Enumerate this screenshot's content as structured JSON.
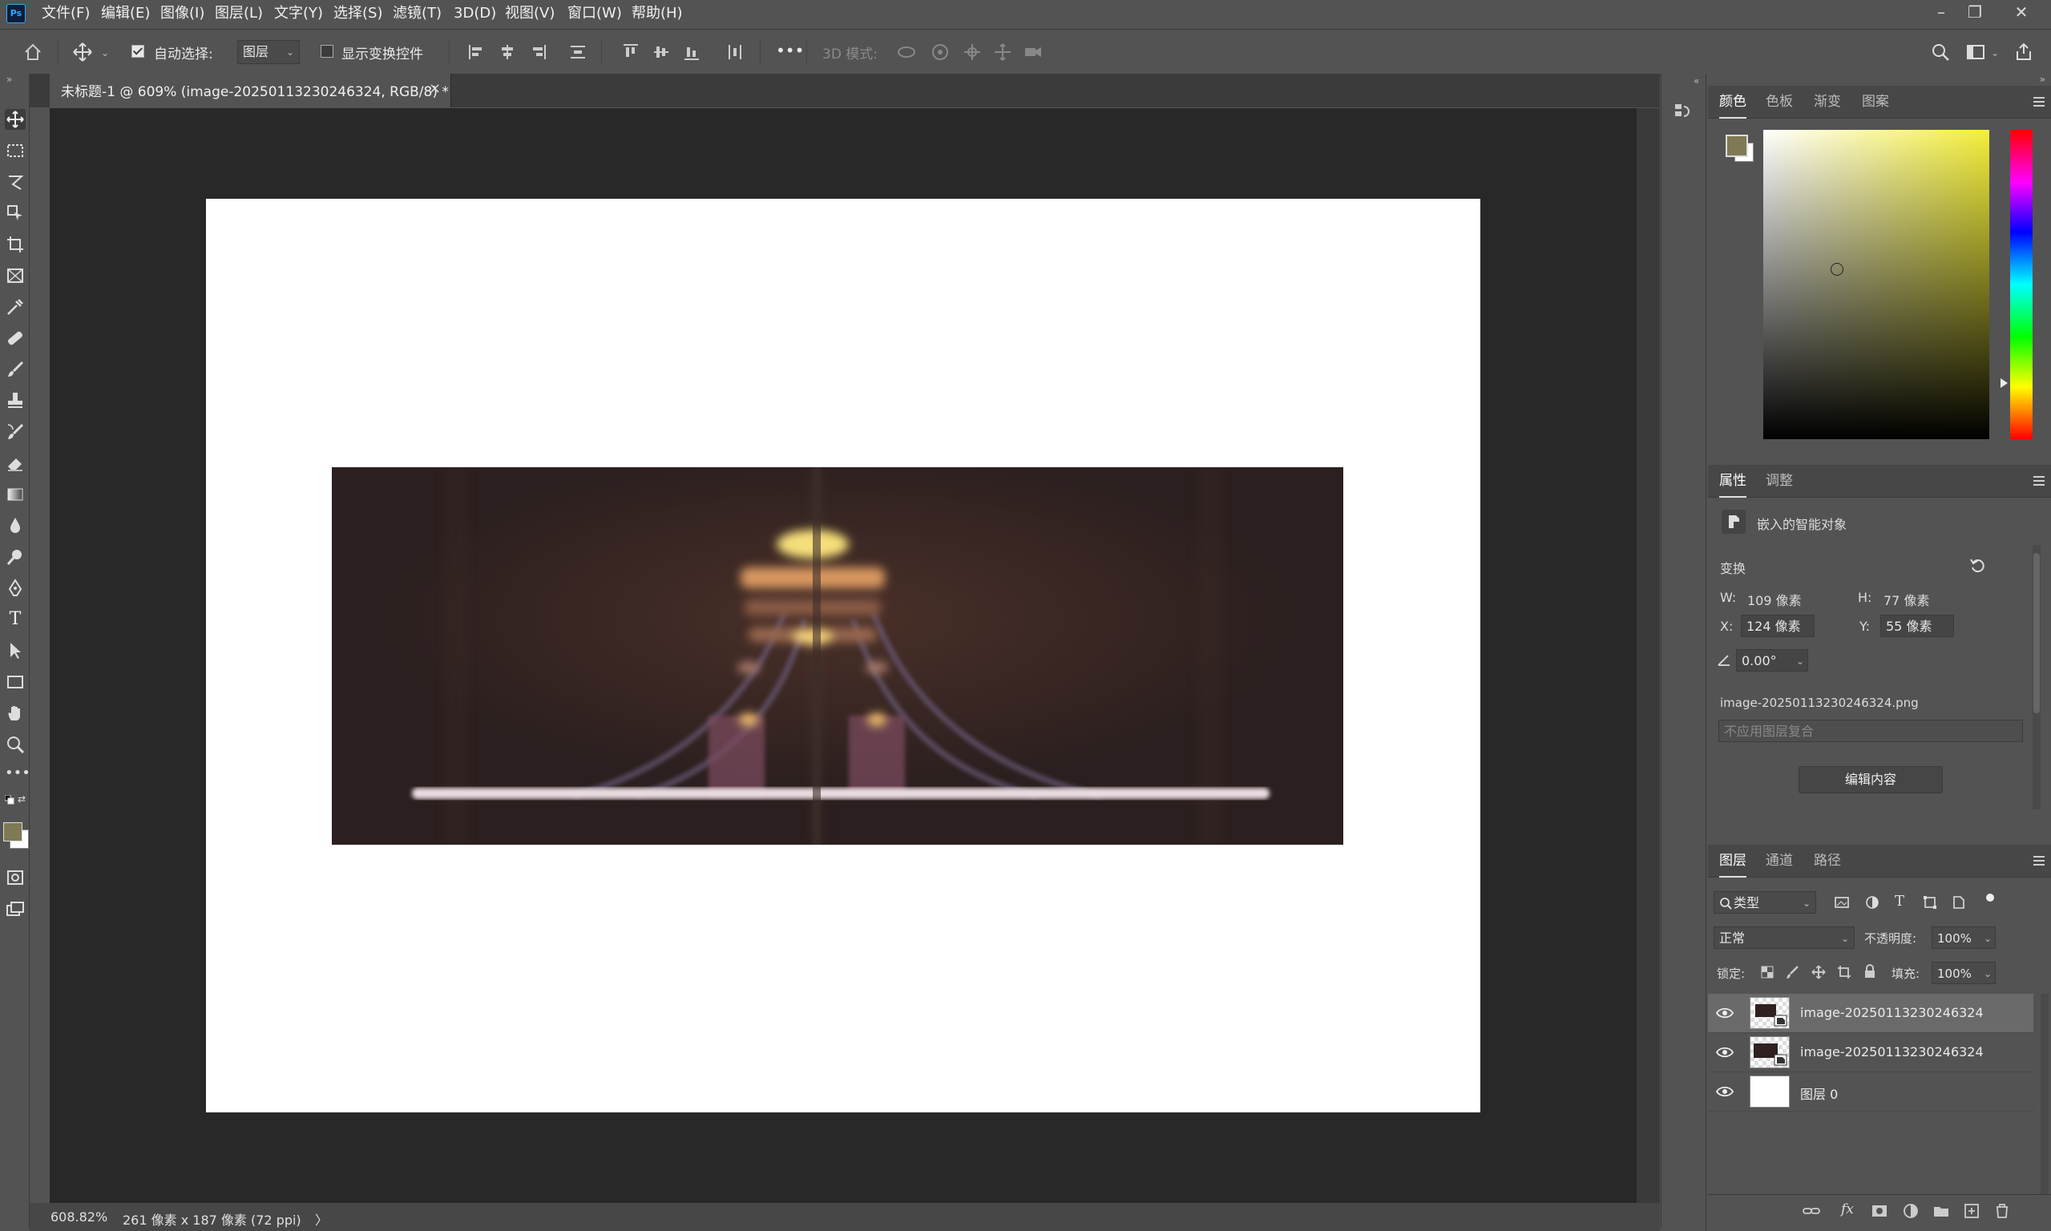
{
  "app": {
    "logo_text": "Ps"
  },
  "menu": [
    {
      "label": "文件(F)"
    },
    {
      "label": "编辑(E)"
    },
    {
      "label": "图像(I)"
    },
    {
      "label": "图层(L)"
    },
    {
      "label": "文字(Y)"
    },
    {
      "label": "选择(S)"
    },
    {
      "label": "滤镜(T)"
    },
    {
      "label": "3D(D)"
    },
    {
      "label": "视图(V)"
    },
    {
      "label": "窗口(W)"
    },
    {
      "label": "帮助(H)"
    }
  ],
  "window_controls": {
    "minimize": "–",
    "restore": "❐",
    "close": "✕"
  },
  "options_bar": {
    "auto_select_label": "自动选择:",
    "auto_select_checked": true,
    "auto_select_target": "图层",
    "show_transform_label": "显示变换控件",
    "show_transform_checked": false,
    "more_label": "•••",
    "mode_3d_label": "3D 模式:"
  },
  "document": {
    "tab_title": "未标题-1 @ 609% (image-20250113230246324, RGB/8) *",
    "close_glyph": "×"
  },
  "status_bar": {
    "zoom": "608.82%",
    "doc_info": "261 像素 x 187 像素 (72 ppi)",
    "arrow": "〉"
  },
  "colors": {
    "foreground": "#7f7a55",
    "background": "#ffffff",
    "accent": "#31a8ff",
    "hue_color": "#f4ef3a"
  },
  "color_panel": {
    "tabs": [
      {
        "label": "颜色"
      },
      {
        "label": "色板"
      },
      {
        "label": "渐变"
      },
      {
        "label": "图案"
      }
    ]
  },
  "properties_panel": {
    "tabs": [
      {
        "label": "属性"
      },
      {
        "label": "调整"
      }
    ],
    "object_type": "嵌入的智能对象",
    "section_title": "变换",
    "w_label": "W:",
    "w_value": "109 像素",
    "h_label": "H:",
    "h_value": "77 像素",
    "x_label": "X:",
    "x_value": "124 像素",
    "y_label": "Y:",
    "y_value": "55 像素",
    "angle_value": "0.00°",
    "filename": "image-20250113230246324.png",
    "layer_comp_placeholder": "不应用图层复合",
    "edit_button": "编辑内容"
  },
  "layers_panel": {
    "tabs": [
      {
        "label": "图层"
      },
      {
        "label": "通道"
      },
      {
        "label": "路径"
      }
    ],
    "filter_label": "类型",
    "blend_mode": "正常",
    "opacity_label": "不透明度:",
    "opacity_value": "100%",
    "lock_label": "锁定:",
    "fill_label": "填充:",
    "fill_value": "100%",
    "layers": [
      {
        "name": "image-20250113230246324",
        "selected": true,
        "visible": true
      },
      {
        "name": "image-20250113230246324",
        "selected": false,
        "visible": true
      },
      {
        "name": "图层 0",
        "selected": false,
        "visible": true
      }
    ]
  }
}
